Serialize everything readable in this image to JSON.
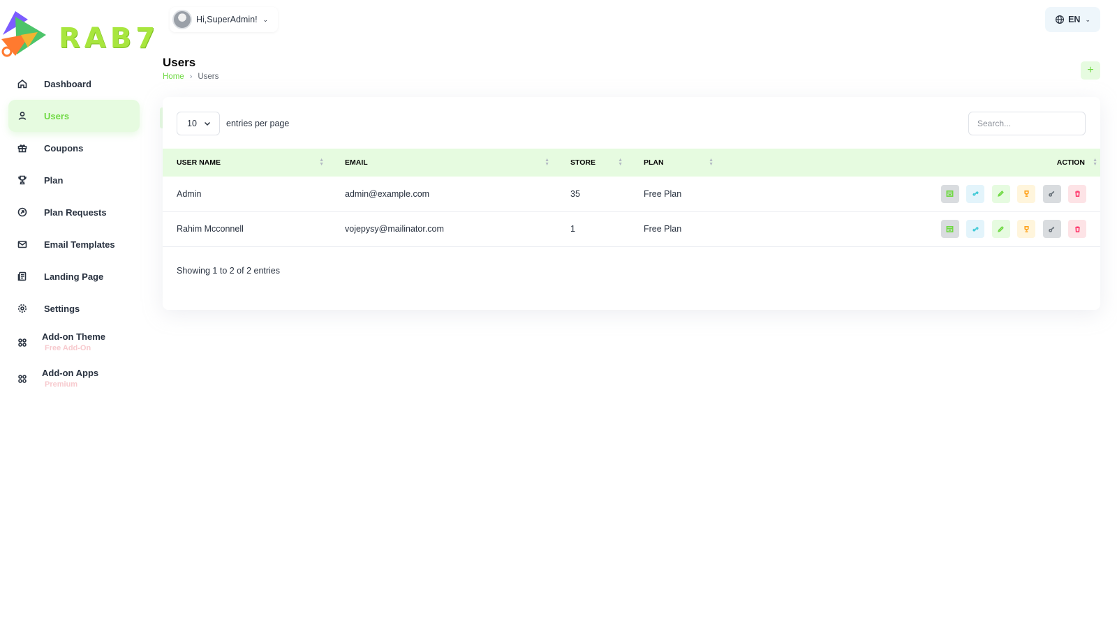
{
  "brand": {
    "logo_text": "RAB7"
  },
  "header": {
    "greeting": "Hi,SuperAdmin!",
    "language": "EN"
  },
  "sidebar": {
    "items": [
      {
        "label": "Dashboard",
        "icon": "home-icon"
      },
      {
        "label": "Users",
        "icon": "user-icon",
        "active": true
      },
      {
        "label": "Coupons",
        "icon": "gift-icon"
      },
      {
        "label": "Plan",
        "icon": "trophy-icon"
      },
      {
        "label": "Plan Requests",
        "icon": "arrow-circle-icon"
      },
      {
        "label": "Email Templates",
        "icon": "mail-icon"
      },
      {
        "label": "Landing Page",
        "icon": "clipboard-icon"
      },
      {
        "label": "Settings",
        "icon": "gear-icon"
      },
      {
        "label": "Add-on Theme",
        "sub": "Free Add-On",
        "icon": "grid-icon"
      },
      {
        "label": "Add-on Apps",
        "sub": "Premium",
        "icon": "grid-icon"
      }
    ]
  },
  "page": {
    "title": "Users",
    "breadcrumb": {
      "home": "Home",
      "current": "Users"
    },
    "add_button": "+"
  },
  "table": {
    "entries_value": "10",
    "entries_label": "entries per page",
    "search_placeholder": "Search...",
    "columns": [
      "USER NAME",
      "EMAIL",
      "STORE",
      "PLAN",
      "ACTION"
    ],
    "rows": [
      {
        "user_name": "Admin",
        "email": "admin@example.com",
        "store": "35",
        "plan": "Free Plan"
      },
      {
        "user_name": "Rahim Mcconnell",
        "email": "vojepysy@mailinator.com",
        "store": "1",
        "plan": "Free Plan"
      }
    ],
    "showing": "Showing 1 to 2 of 2 entries"
  },
  "colors": {
    "accent": "#6fd943",
    "accent_light": "#e6fbe0",
    "text": "#293240",
    "danger": "#ff3a6e",
    "warning": "#ffa21d",
    "info": "#3ec9d6"
  }
}
